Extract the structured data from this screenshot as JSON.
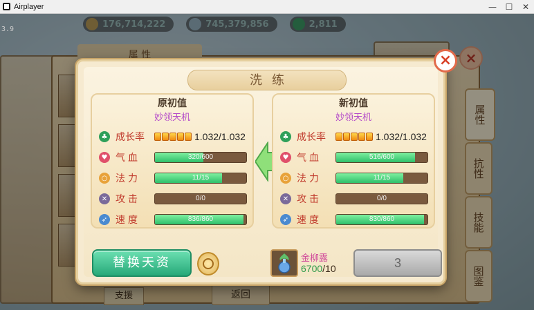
{
  "window": {
    "title": "Airplayer",
    "minimize": "—",
    "maximize": "☐",
    "close": "✕"
  },
  "hud": {
    "fps": "3.9",
    "currencies": [
      {
        "value": "176,714,222",
        "color": "#bfa15a"
      },
      {
        "value": "745,379,856",
        "color": "#9bb9c9"
      },
      {
        "value": "2,811",
        "color": "#3fa06a"
      }
    ]
  },
  "background": {
    "attr_title": "属 性",
    "tabs": [
      "属性",
      "抗性",
      "技能",
      "图鉴"
    ],
    "support_button": "支援",
    "return_button": "返回"
  },
  "modal": {
    "title": "洗练",
    "close_icon": "close-icon",
    "left": {
      "heading": "原初值",
      "subheading": "妙领天机"
    },
    "right": {
      "heading": "新初值",
      "subheading": "妙领天机"
    },
    "stat_labels": {
      "growth": "成长率",
      "hp": "气血",
      "mp": "法力",
      "attack": "攻击",
      "speed": "速度"
    },
    "left_stats": {
      "growth": "1.032/1.032",
      "hp": {
        "text": "320/600",
        "fill": 0.533
      },
      "mp": {
        "text": "11/15",
        "fill": 0.733
      },
      "attack": {
        "text": "0/0",
        "fill": 0
      },
      "speed": {
        "text": "836/860",
        "fill": 0.972
      }
    },
    "right_stats": {
      "growth": "1.032/1.032",
      "hp": {
        "text": "516/600",
        "fill": 0.86
      },
      "mp": {
        "text": "11/15",
        "fill": 0.733
      },
      "attack": {
        "text": "0/0",
        "fill": 0
      },
      "speed": {
        "text": "830/860",
        "fill": 0.965
      }
    },
    "growth_pips": 5,
    "replace_button": "替换天资",
    "item": {
      "name": "金柳露",
      "have": "6700",
      "need": "/10"
    },
    "confirm_button": "3"
  },
  "colors": {
    "accent_green": "#2fbf6a",
    "label_red": "#c0392b",
    "purple": "#b44bc9"
  }
}
